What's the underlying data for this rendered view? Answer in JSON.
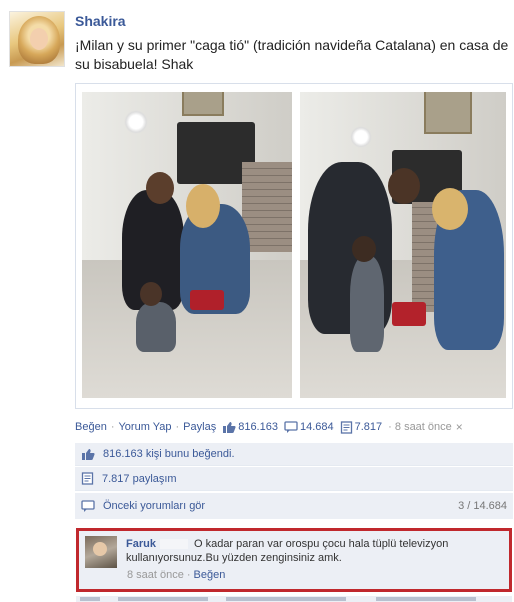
{
  "post": {
    "author": "Shakira",
    "message": "¡Milan y su primer \"caga tió\" (tradición navideña Catalana) en casa de su bisabuela! Shak"
  },
  "actions": {
    "like": "Beğen",
    "comment": "Yorum Yap",
    "share": "Paylaş",
    "like_count": "816.163",
    "comment_count": "14.684",
    "share_count": "7.817",
    "time": "8 saat önce",
    "separator": "·"
  },
  "feedback": {
    "likes_text": "816.163 kişi bunu beğendi.",
    "shares_text": "7.817 paylaşım",
    "prev_comments": "Önceki yorumları gör",
    "comment_progress": "3 / 14.684"
  },
  "comment": {
    "author": "Faruk",
    "text": "O kadar paran var orospu çocu hala tüplü televizyon kullanıyorsunuz.Bu yüzden zenginsiniz amk.",
    "time": "8 saat önce",
    "like": "Beğen",
    "separator": "·"
  },
  "colors": {
    "link": "#3b5998",
    "feedback_bg": "#eceff5",
    "highlight_border": "#c0282d"
  },
  "icons": {
    "like_stat": "thumbs-up-icon",
    "comment_stat": "comment-bubble-icon",
    "share_stat": "share-document-icon",
    "likes_row": "thumbs-up-icon",
    "shares_row": "share-document-icon",
    "prev_row": "comment-bubble-icon"
  }
}
